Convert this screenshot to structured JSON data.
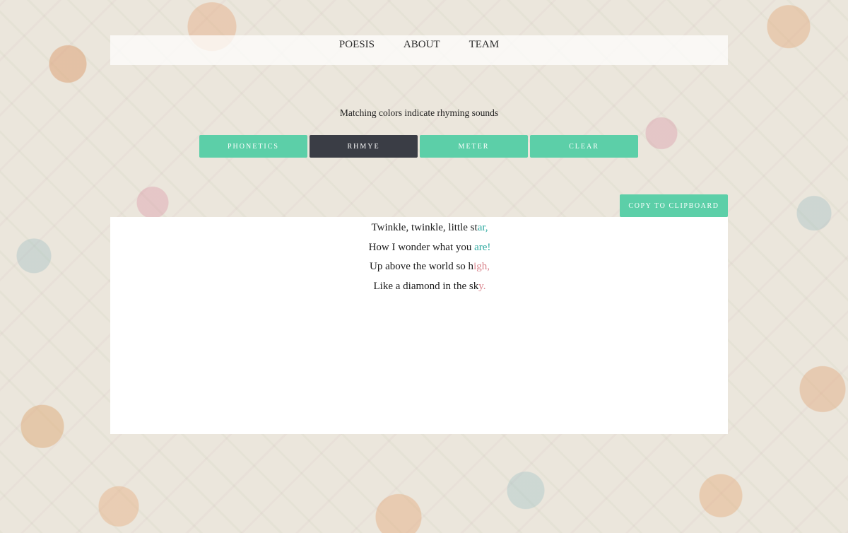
{
  "nav": {
    "items": [
      "POESIS",
      "ABOUT",
      "TEAM"
    ]
  },
  "hint": "Matching colors indicate rhyming sounds",
  "modes": {
    "phonetics": "PHONETICS",
    "rhyme": "RHMYE",
    "meter": "METER",
    "clear": "CLEAR",
    "active": "RHMYE"
  },
  "copy_label": "COPY TO CLIPBOARD",
  "poem": {
    "lines": [
      {
        "plain": "Twinkle, twinkle, little st",
        "rhyme": "ar,",
        "group": "a"
      },
      {
        "plain": "How I wonder what you ",
        "rhyme": "are!",
        "group": "a"
      },
      {
        "plain": "Up above the world so h",
        "rhyme": "igh,",
        "group": "b"
      },
      {
        "plain": "Like a diamond in the sk",
        "rhyme": "y.",
        "group": "b"
      }
    ]
  },
  "colors": {
    "button": "#5ccfa8",
    "button_active": "#3a3d45",
    "rhyme_a": "#2ea9a0",
    "rhyme_b": "#d9828b"
  }
}
